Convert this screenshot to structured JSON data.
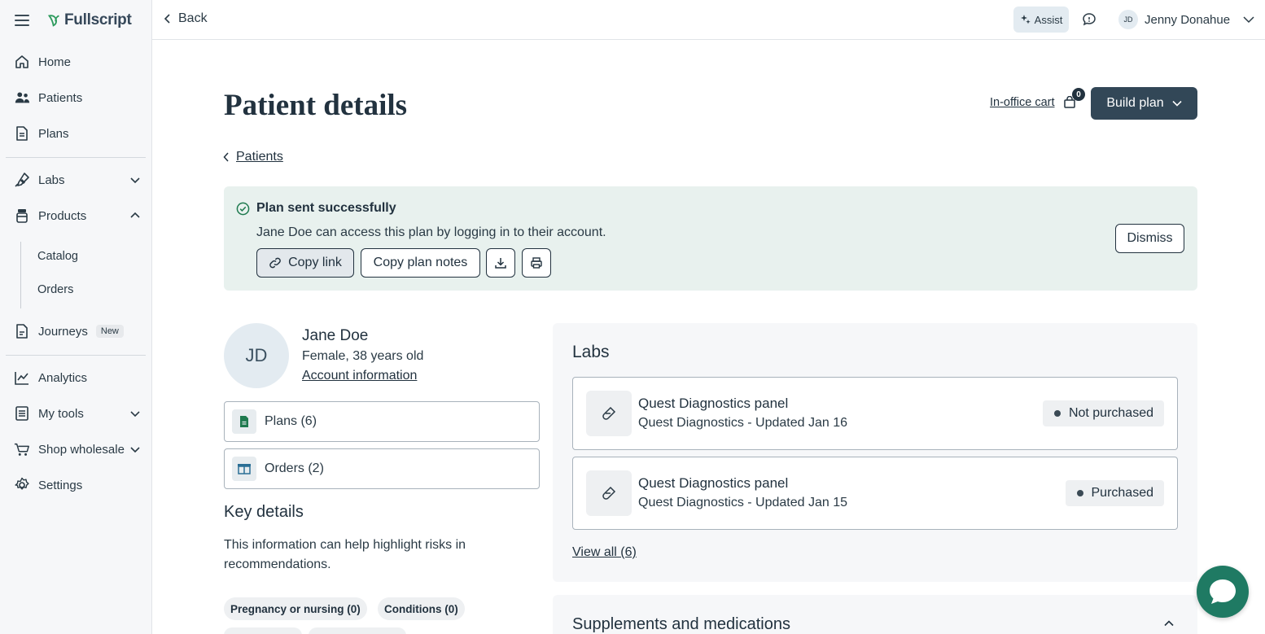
{
  "brand": {
    "name": "Fullscript",
    "color": "#2e9b5e"
  },
  "sidebar": {
    "items": [
      {
        "label": "Home",
        "icon": "home-icon"
      },
      {
        "label": "Patients",
        "icon": "patients-icon"
      },
      {
        "label": "Plans",
        "icon": "plans-icon"
      },
      {
        "label": "Labs",
        "icon": "labs-icon",
        "expanded": false
      },
      {
        "label": "Products",
        "icon": "products-icon",
        "expanded": true
      },
      {
        "label": "Journeys",
        "icon": "journeys-icon",
        "badge": "New"
      },
      {
        "label": "Analytics",
        "icon": "analytics-icon"
      },
      {
        "label": "My tools",
        "icon": "tools-icon",
        "expanded": false
      },
      {
        "label": "Shop wholesale",
        "icon": "cart-icon",
        "expanded": false
      },
      {
        "label": "Settings",
        "icon": "gear-icon"
      }
    ],
    "products_sub": [
      "Catalog",
      "Orders"
    ]
  },
  "topbar": {
    "back_label": "Back",
    "assist_label": "Assist",
    "user_initials": "JD",
    "user_name": "Jenny Donahue"
  },
  "page": {
    "title": "Patient details",
    "cart_label": "In-office cart",
    "cart_count": "0",
    "build_plan_label": "Build plan",
    "breadcrumb": "Patients"
  },
  "alert": {
    "title": "Plan sent successfully",
    "message": "Jane Doe can access this plan by logging in to their account.",
    "copy_link": "Copy link",
    "copy_notes": "Copy plan notes",
    "dismiss": "Dismiss",
    "bg_color": "#e8f1ee"
  },
  "patient": {
    "initials": "JD",
    "name": "Jane Doe",
    "details": "Female, 38 years old",
    "account_link": "Account information",
    "plans": "Plans (6)",
    "orders": "Orders (2)"
  },
  "key_details": {
    "title": "Key details",
    "text": "This information can help highlight risks in recommendations.",
    "chips": [
      "Pregnancy or nursing (0)",
      "Conditions (0)"
    ]
  },
  "labs": {
    "title": "Labs",
    "items": [
      {
        "name": "Quest Diagnostics panel",
        "sub": "Quest Diagnostics - Updated Jan 16",
        "status": "Not purchased"
      },
      {
        "name": "Quest Diagnostics panel",
        "sub": "Quest Diagnostics - Updated Jan 15",
        "status": "Purchased"
      }
    ],
    "view_all": "View all (6)"
  },
  "supplements": {
    "title": "Supplements and medications"
  }
}
